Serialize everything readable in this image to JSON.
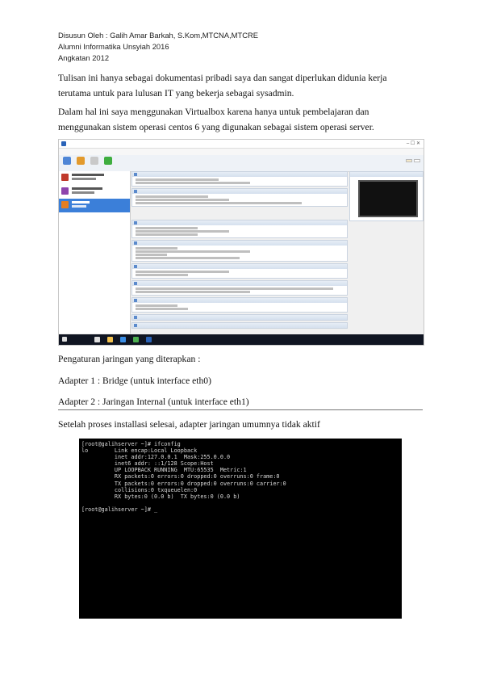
{
  "header": {
    "line1": "Disusun Oleh : Galih Amar Barkah, S.Kom,MTCNA,MTCRE",
    "line2": "Alumni Informatika Unsyiah 2016",
    "line3": "Angkatan 2012"
  },
  "paragraphs": {
    "intro": "Tulisan ini hanya sebagai dokumentasi pribadi saya dan sangat diperlukan didunia kerja terutama untuk para lulusan IT yang bekerja sebagai sysadmin.",
    "vbox": "Dalam hal ini saya menggunakan Virtualbox karena hanya untuk pembelajaran dan menggunakan sistem operasi centos 6 yang digunakan sebagai sistem operasi server."
  },
  "network": {
    "heading": "Pengaturan jaringan yang diterapkan :",
    "adapter1": "Adapter 1 : Bridge (untuk interface eth0)",
    "adapter2": "Adapter 2 : Jaringan Internal (untuk interface eth1)",
    "after_install": "Setelah proses installasi selesai, adapter jaringan umumnya tidak aktif"
  },
  "terminal": {
    "lines": [
      "[root@galihserver ~]# ifconfig",
      "lo        Link encap:Local Loopback",
      "          inet addr:127.0.0.1  Mask:255.0.0.0",
      "          inet6 addr: ::1/128 Scope:Host",
      "          UP LOOPBACK RUNNING  MTU:65535  Metric:1",
      "          RX packets:0 errors:0 dropped:0 overruns:0 frame:0",
      "          TX packets:0 errors:0 dropped:0 overruns:0 carrier:0",
      "          collisions:0 txqueuelen:0",
      "          RX bytes:0 (0.0 b)  TX bytes:0 (0.0 b)",
      "",
      "[root@galihserver ~]# _"
    ]
  },
  "colors": {
    "terminal_bg": "#000000",
    "terminal_fg": "#d8d8d8",
    "vbox_selected": "#3b7fd9"
  }
}
